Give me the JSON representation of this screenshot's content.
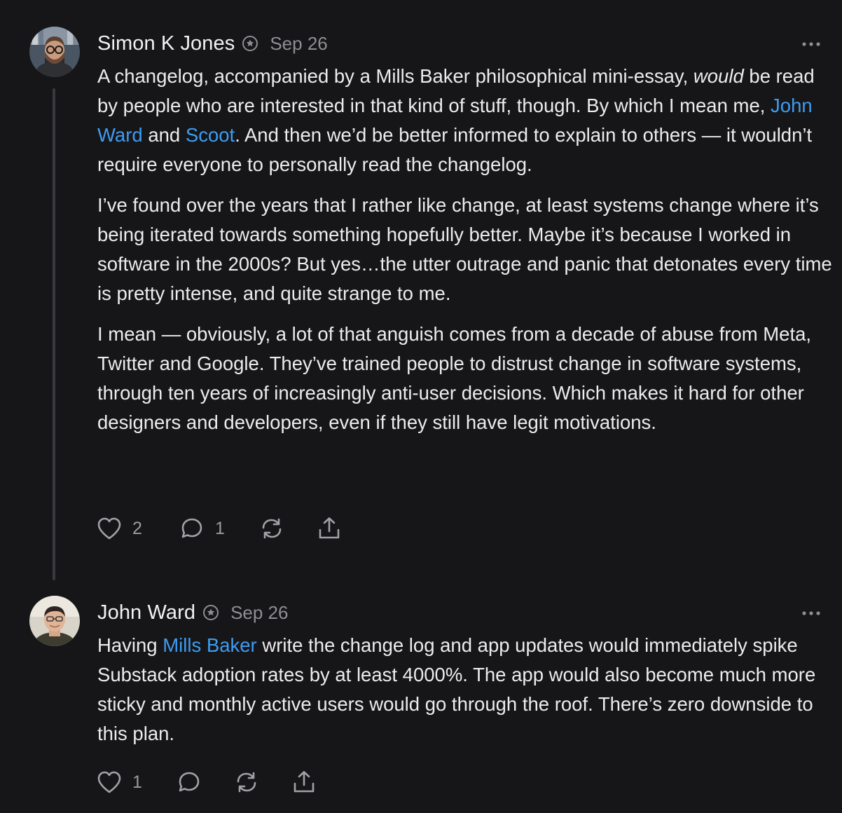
{
  "comments": [
    {
      "author": "Simon K Jones",
      "date": "Sep 26",
      "badge_icon": "subscriber-badge-icon",
      "paragraphs": [
        [
          {
            "text": "A changelog, accompanied by a Mills Baker philosophical mini-essay, "
          },
          {
            "text": "would",
            "italic": true
          },
          {
            "text": " be read by people who are interested in that kind of stuff, though. By which I mean me, "
          },
          {
            "text": "John Ward",
            "link": true
          },
          {
            "text": " and "
          },
          {
            "text": "Scoot",
            "link": true
          },
          {
            "text": ". And then we’d be better informed to explain to others — it wouldn’t require everyone to personally read the changelog."
          }
        ],
        [
          {
            "text": "I’ve found over the years that I rather like change, at least systems change where it’s being iterated towards something hopefully better. Maybe it’s because I worked in software in the 2000s? But yes…the utter outrage and panic that detonates every time is pretty intense, and quite strange to me."
          }
        ],
        [
          {
            "text": "I mean — obviously, a lot of that anguish comes from a decade of abuse from Meta, Twitter and Google. They’ve trained people to distrust change in software systems, through ten years of increasingly anti-user decisions. Which makes it hard for other designers and developers, even if they still have legit motivations."
          }
        ]
      ],
      "likes": "2",
      "replies": "1"
    },
    {
      "author": "John Ward",
      "date": "Sep 26",
      "badge_icon": "subscriber-badge-icon",
      "paragraphs": [
        [
          {
            "text": "Having "
          },
          {
            "text": "Mills Baker",
            "link": true
          },
          {
            "text": " write the change log and app updates would immediately spike Substack adoption rates by at least 4000%. The app would also become much more sticky and monthly active users would go through the roof. There’s zero downside to this plan."
          }
        ]
      ],
      "likes": "1",
      "replies": ""
    }
  ],
  "icons": {
    "like": "heart-icon",
    "reply": "speech-bubble-icon",
    "restack": "restack-icon",
    "share": "share-icon",
    "more": "more-options-icon"
  },
  "colors": {
    "background": "#161618",
    "text": "#ececee",
    "muted": "#8e8e93",
    "link": "#3d9cf2",
    "thread_line": "#3a3a3e"
  }
}
